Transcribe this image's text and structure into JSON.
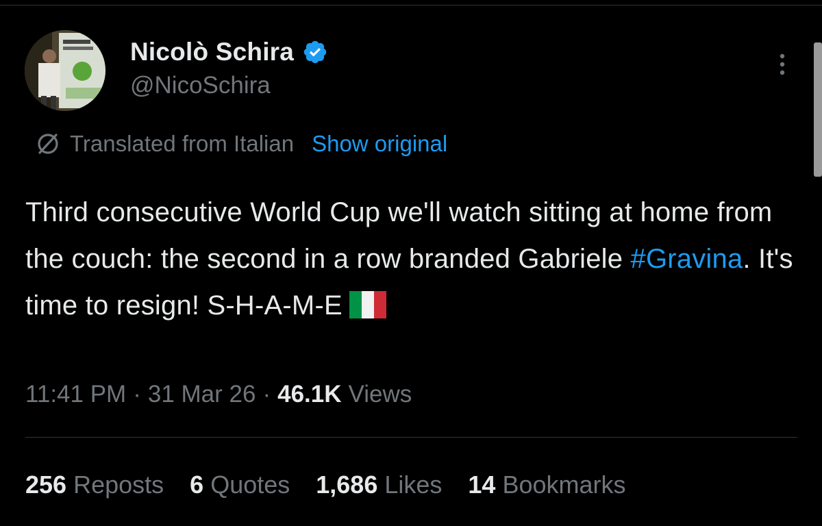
{
  "author": {
    "name": "Nicolò Schira",
    "handle": "@NicoSchira",
    "verified_icon": "verified-badge-icon",
    "avatar_icon": "profile-avatar"
  },
  "translation": {
    "label": "Translated from Italian",
    "show_original_label": "Show original",
    "icon": "translate-icon"
  },
  "tweet": {
    "text_part1": "Third consecutive World Cup we'll watch sitting at home from the couch: the second in a row branded Gabriele ",
    "hashtag": "#Gravina",
    "text_part2": ". It's time to resign! S-H-A-M-E",
    "flag_icon": "italy-flag-icon"
  },
  "meta": {
    "time": "11:41 PM",
    "separator": "·",
    "date": "31 Mar 26",
    "views_count": "46.1K",
    "views_label": "Views"
  },
  "stats": [
    {
      "count": "256",
      "label": "Reposts"
    },
    {
      "count": "6",
      "label": "Quotes"
    },
    {
      "count": "1,686",
      "label": "Likes"
    },
    {
      "count": "14",
      "label": "Bookmarks"
    }
  ],
  "colors": {
    "background": "#000000",
    "text": "#e7e9ea",
    "secondary": "#71767b",
    "accent": "#1d9bf0",
    "divider": "#2f3336"
  }
}
